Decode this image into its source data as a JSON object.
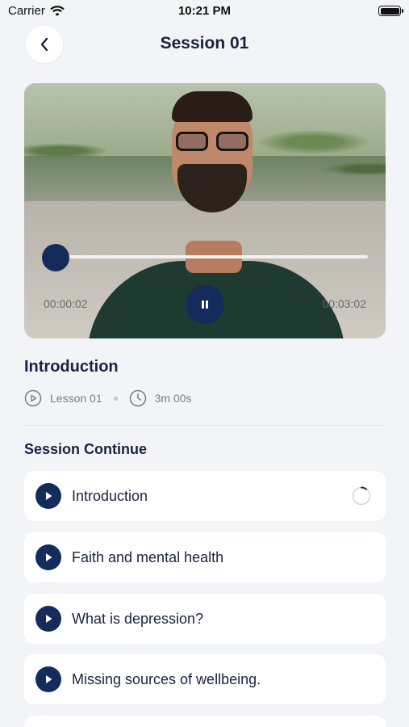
{
  "status_bar": {
    "carrier": "Carrier",
    "time": "10:21 PM"
  },
  "header": {
    "title": "Session 01"
  },
  "video": {
    "current_time": "00:00:02",
    "total_time": "00:03:02",
    "progress": 0.01
  },
  "lesson": {
    "title": "Introduction",
    "lesson_label": "Lesson 01",
    "duration": "3m 00s"
  },
  "session": {
    "title": "Session Continue",
    "items": [
      {
        "label": "Introduction"
      },
      {
        "label": "Faith and mental health"
      },
      {
        "label": "What is depression?"
      },
      {
        "label": "Missing sources of wellbeing."
      }
    ]
  },
  "colors": {
    "accent": "#142c5c",
    "background": "#f3f4f7",
    "title": "#1b2240"
  },
  "icons": {
    "back": "chevron-left-icon",
    "pause": "pause-icon",
    "play": "play-icon",
    "clock": "clock-icon",
    "loading": "spinner-icon"
  }
}
